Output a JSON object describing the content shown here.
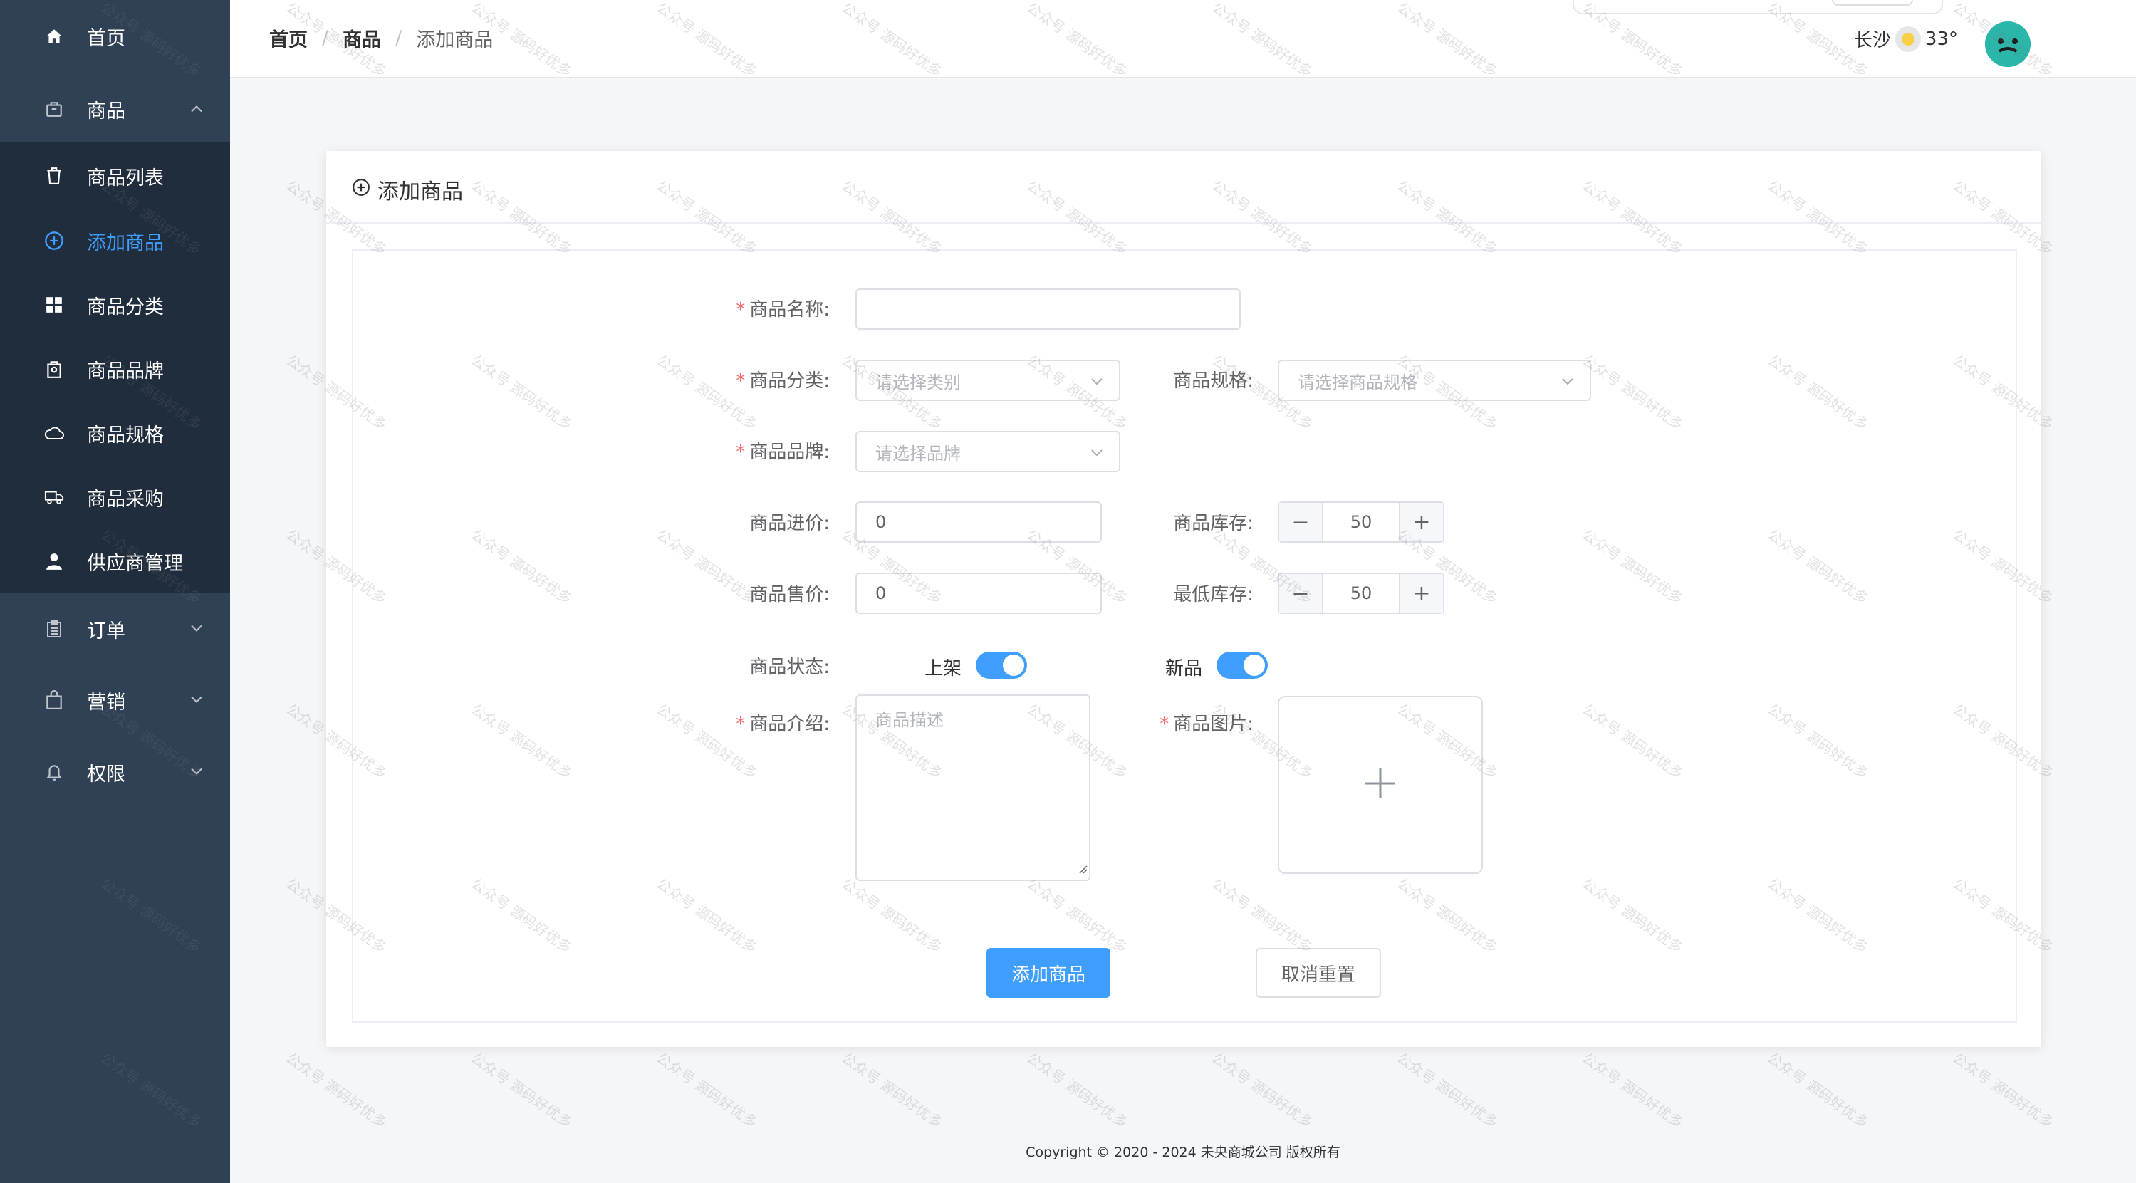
{
  "sidebar": {
    "items": [
      {
        "label": "首页",
        "icon": "home-icon"
      },
      {
        "label": "商品",
        "icon": "bag-icon"
      },
      {
        "label": "商品列表",
        "icon": "trash-icon"
      },
      {
        "label": "添加商品",
        "icon": "plus-circle-icon"
      },
      {
        "label": "商品分类",
        "icon": "grid-icon"
      },
      {
        "label": "商品品牌",
        "icon": "tag-icon"
      },
      {
        "label": "商品规格",
        "icon": "cloud-icon"
      },
      {
        "label": "商品采购",
        "icon": "truck-icon"
      },
      {
        "label": "供应商管理",
        "icon": "user-icon"
      },
      {
        "label": "订单",
        "icon": "clipboard-icon"
      },
      {
        "label": "营销",
        "icon": "shopping-bag-icon"
      },
      {
        "label": "权限",
        "icon": "bell-icon"
      }
    ]
  },
  "header": {
    "breadcrumb": [
      "首页",
      "商品",
      "添加商品"
    ],
    "city": "长沙",
    "temperature": "33°"
  },
  "card": {
    "title": "添加商品"
  },
  "form": {
    "name_label": "商品名称:",
    "name_value": "",
    "category_label": "商品分类:",
    "category_placeholder": "请选择类别",
    "spec_label": "商品规格:",
    "spec_placeholder": "请选择商品规格",
    "brand_label": "商品品牌:",
    "brand_placeholder": "请选择品牌",
    "purchase_price_label": "商品进价:",
    "purchase_price_value": "0",
    "stock_label": "商品库存:",
    "stock_value": "50",
    "sale_price_label": "商品售价:",
    "sale_price_value": "0",
    "min_stock_label": "最低库存:",
    "min_stock_value": "50",
    "status_label": "商品状态:",
    "on_shelf_label": "上架",
    "new_label": "新品",
    "desc_label": "商品介绍:",
    "desc_placeholder": "商品描述",
    "image_label": "商品图片:",
    "submit_label": "添加商品",
    "reset_label": "取消重置"
  },
  "watermark": "公众号 源码好优多",
  "footer": "Copyright © 2020 - 2024  未央商城公司 版权所有",
  "colors": {
    "sidebar": "#304156",
    "submenu": "#1f2d3d",
    "accent": "#409eff",
    "required": "#f56c6c"
  }
}
